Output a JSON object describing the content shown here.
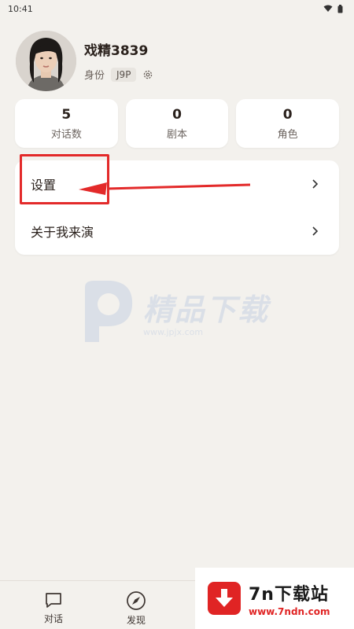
{
  "status_bar": {
    "time": "10:41"
  },
  "profile": {
    "username": "戏精3839",
    "identity_label": "身份",
    "identity_value": "J9P"
  },
  "stats": [
    {
      "value": "5",
      "label": "对话数"
    },
    {
      "value": "0",
      "label": "剧本"
    },
    {
      "value": "0",
      "label": "角色"
    }
  ],
  "menu": [
    {
      "label": "设置"
    },
    {
      "label": "关于我来演"
    }
  ],
  "watermark": {
    "title": "精品下载",
    "url": "www.jpjx.com"
  },
  "tabbar": [
    {
      "label": "对话",
      "icon": "chat-bubble-icon"
    },
    {
      "label": "发现",
      "icon": "compass-icon"
    }
  ],
  "ad": {
    "title": "7n下载站",
    "url": "www.7ndn.com"
  },
  "colors": {
    "accent_red": "#e32a2a",
    "background": "#f3f1ed",
    "card": "#ffffff"
  }
}
